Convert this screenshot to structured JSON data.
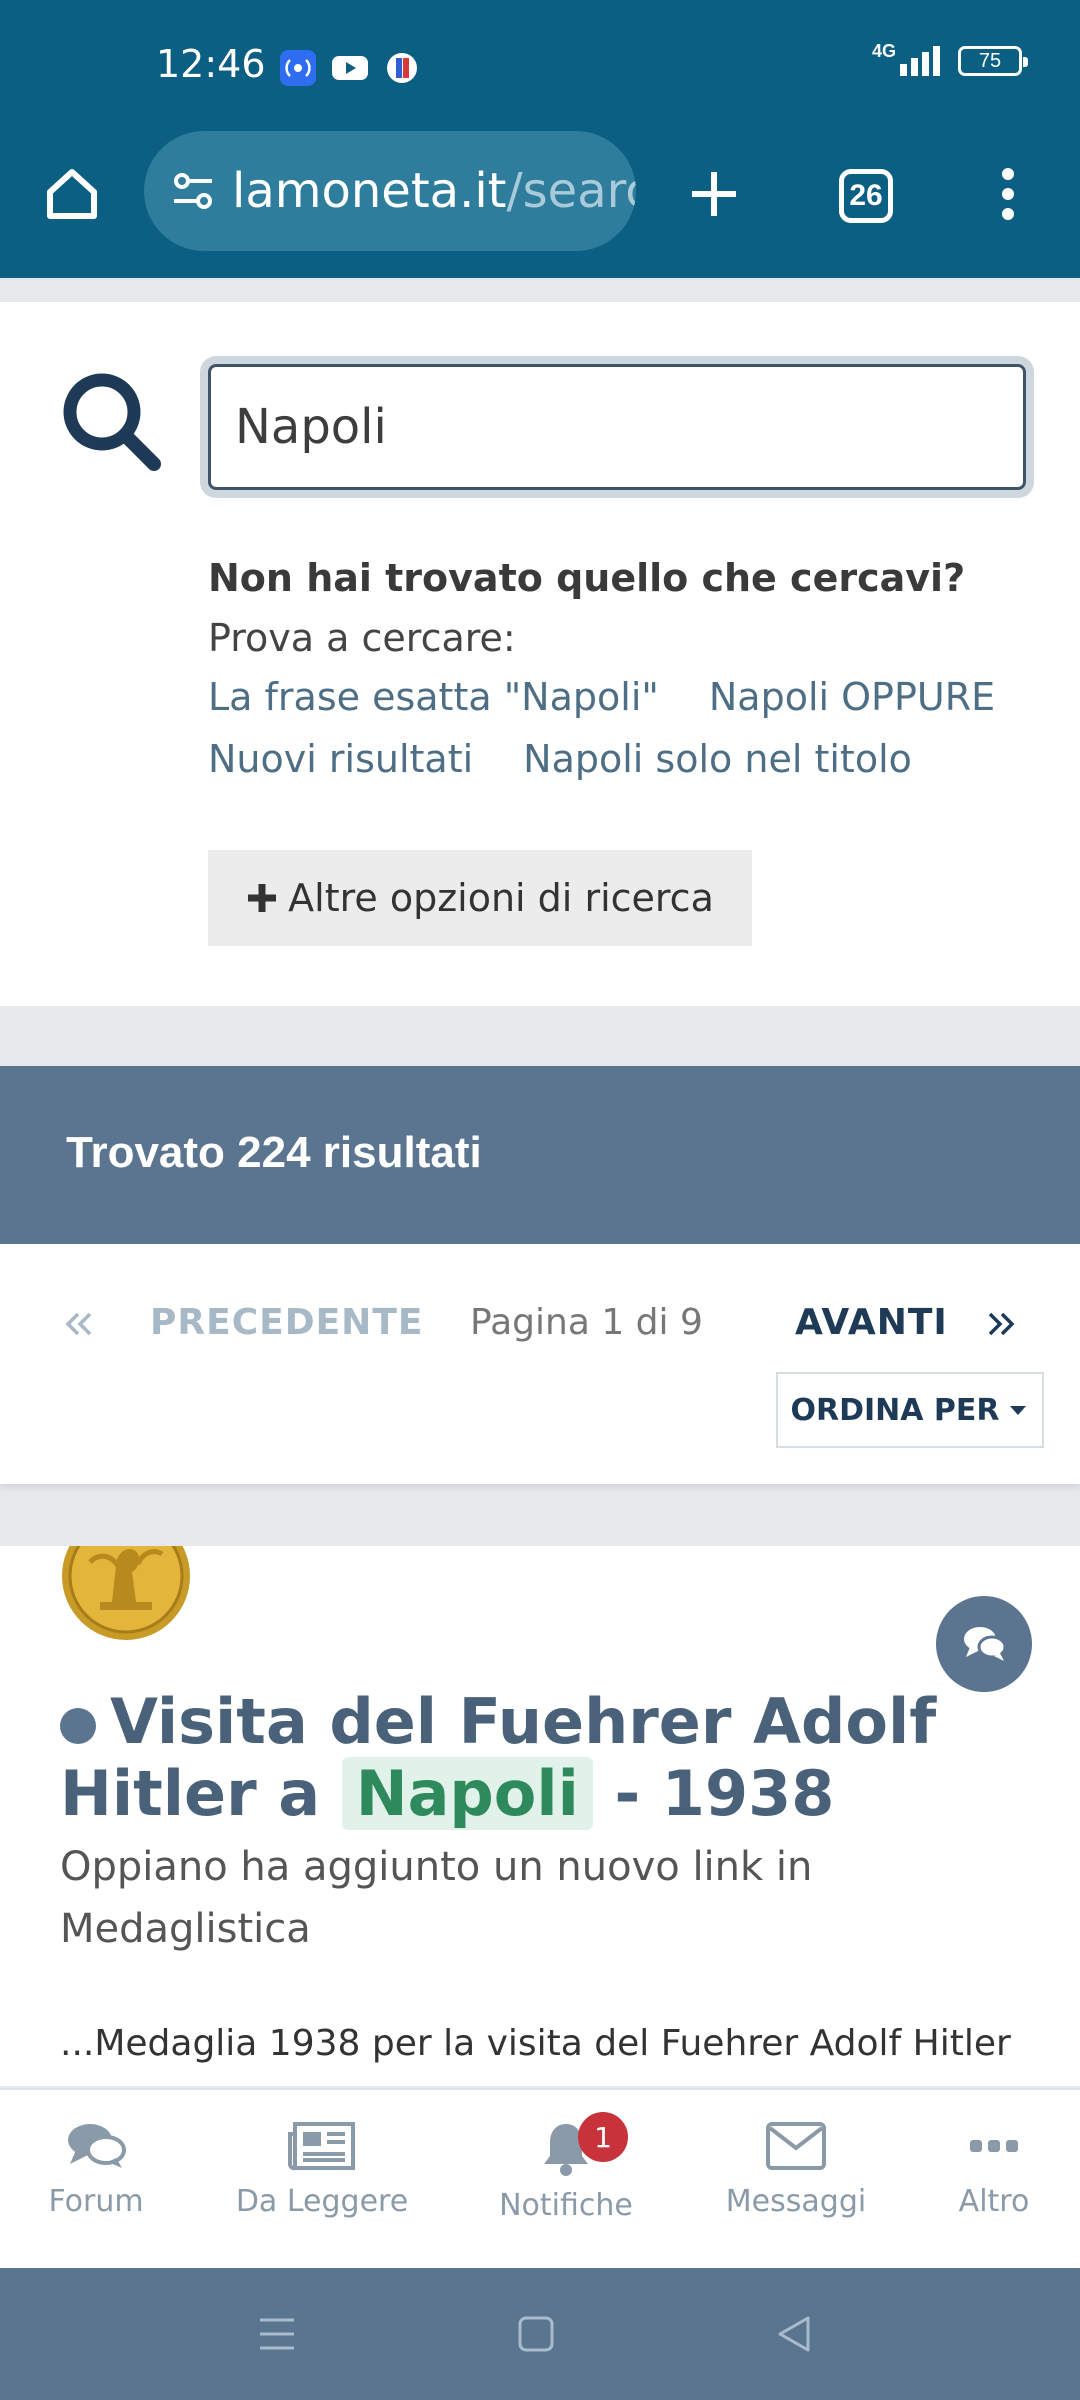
{
  "status_bar": {
    "time": "12:46",
    "network": "4G",
    "battery": "75",
    "icons": [
      "hotspot-icon",
      "youtube-icon",
      "app-icon",
      "signal-icon",
      "battery-icon"
    ]
  },
  "browser": {
    "url_domain": "lamoneta.it",
    "url_path": "/search",
    "tab_count": "26",
    "icons": [
      "home-icon",
      "site-settings-icon",
      "new-tab-icon",
      "tabs-icon",
      "menu-icon"
    ]
  },
  "search": {
    "value": "Napoli",
    "not_found_bold": "Non hai trovato quello che cercavi?",
    "not_found_rest": " Prova a cercare:",
    "links": [
      "La frase esatta \"Napoli\"",
      "Napoli OPPURE",
      "Nuovi risultati",
      "Napoli solo nel titolo"
    ],
    "more_options": "Altre opzioni di ricerca"
  },
  "results": {
    "title": "Trovato 224 risultati"
  },
  "pager": {
    "prev": "PRECEDENTE",
    "info": "Pagina 1 di 9",
    "next": "AVANTI",
    "sort": "ORDINA PER"
  },
  "result_item": {
    "title_pre": "Visita del Fuehrer Adolf Hitler a",
    "title_hl": "Napoli",
    "title_post": " - 1938",
    "subtitle": "Oppiano ha aggiunto un nuovo link in Medaglistica",
    "snippet": "...Medaglia 1938 per la visita del Fuehrer Adolf Hitler"
  },
  "bottom_nav": {
    "forum": "Forum",
    "reading": "Da Leggere",
    "notifications": "Notifiche",
    "notifications_badge": "1",
    "messages": "Messaggi",
    "more": "Altro"
  },
  "colors": {
    "brand": "#0b5f82",
    "header": "#5b7590",
    "highlight": "#2e8a5c",
    "badge": "#c8323a"
  }
}
